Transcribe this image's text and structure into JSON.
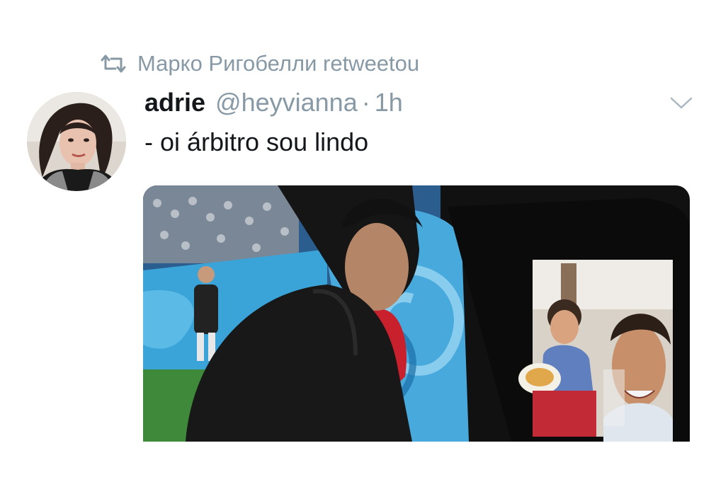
{
  "retweet": {
    "icon": "retweet-icon",
    "text": "Марко Ригобелли retweetou"
  },
  "tweet": {
    "display_name": "adrie",
    "handle": "@heyvianna",
    "separator": "·",
    "time": "1h",
    "text": "- oi árbitro sou lindo",
    "menu_icon": "chevron-down-icon"
  },
  "media": {
    "description_icon": "photo-image"
  },
  "colors": {
    "muted": "#8899a6",
    "text": "#14171a",
    "background": "#ffffff"
  }
}
